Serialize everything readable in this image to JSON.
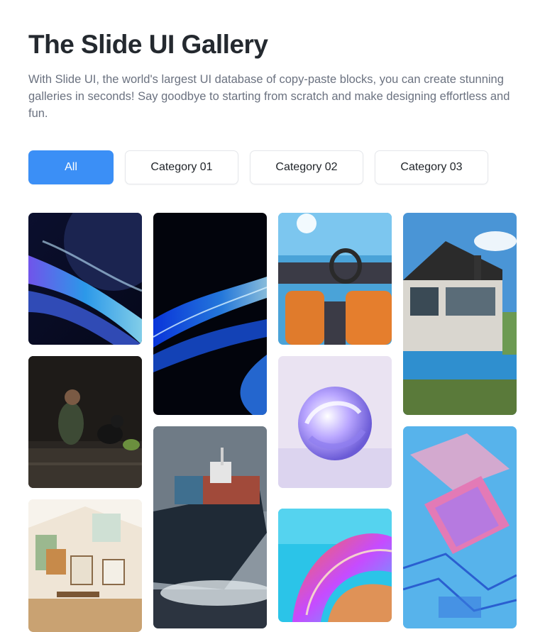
{
  "header": {
    "title": "The Slide UI Gallery",
    "description": "With Slide UI, the world's largest UI database of copy-paste blocks, you can create stunning galleries in seconds! Say goodbye to starting from scratch and make designing effortless and fun."
  },
  "filters": {
    "all": "All",
    "category_01": "Category 01",
    "category_02": "Category 02",
    "category_03": "Category 03"
  },
  "colors": {
    "accent": "#3b8ff6",
    "title": "#24292f",
    "body_text": "#6b7280"
  },
  "gallery": [
    {
      "id": "abstract-blue-waves",
      "subject": "abstract blue waves"
    },
    {
      "id": "man-with-dog",
      "subject": "man with dog"
    },
    {
      "id": "art-studio",
      "subject": "art studio"
    },
    {
      "id": "blue-light-streaks",
      "subject": "blue light streaks"
    },
    {
      "id": "cargo-ship",
      "subject": "cargo ship"
    },
    {
      "id": "car-interior",
      "subject": "car interior"
    },
    {
      "id": "glass-sphere",
      "subject": "glass sphere"
    },
    {
      "id": "colorful-swirl",
      "subject": "colorful swirl"
    },
    {
      "id": "modern-house-pool",
      "subject": "modern house with pool"
    },
    {
      "id": "circuit-chip",
      "subject": "circuit chip"
    }
  ]
}
